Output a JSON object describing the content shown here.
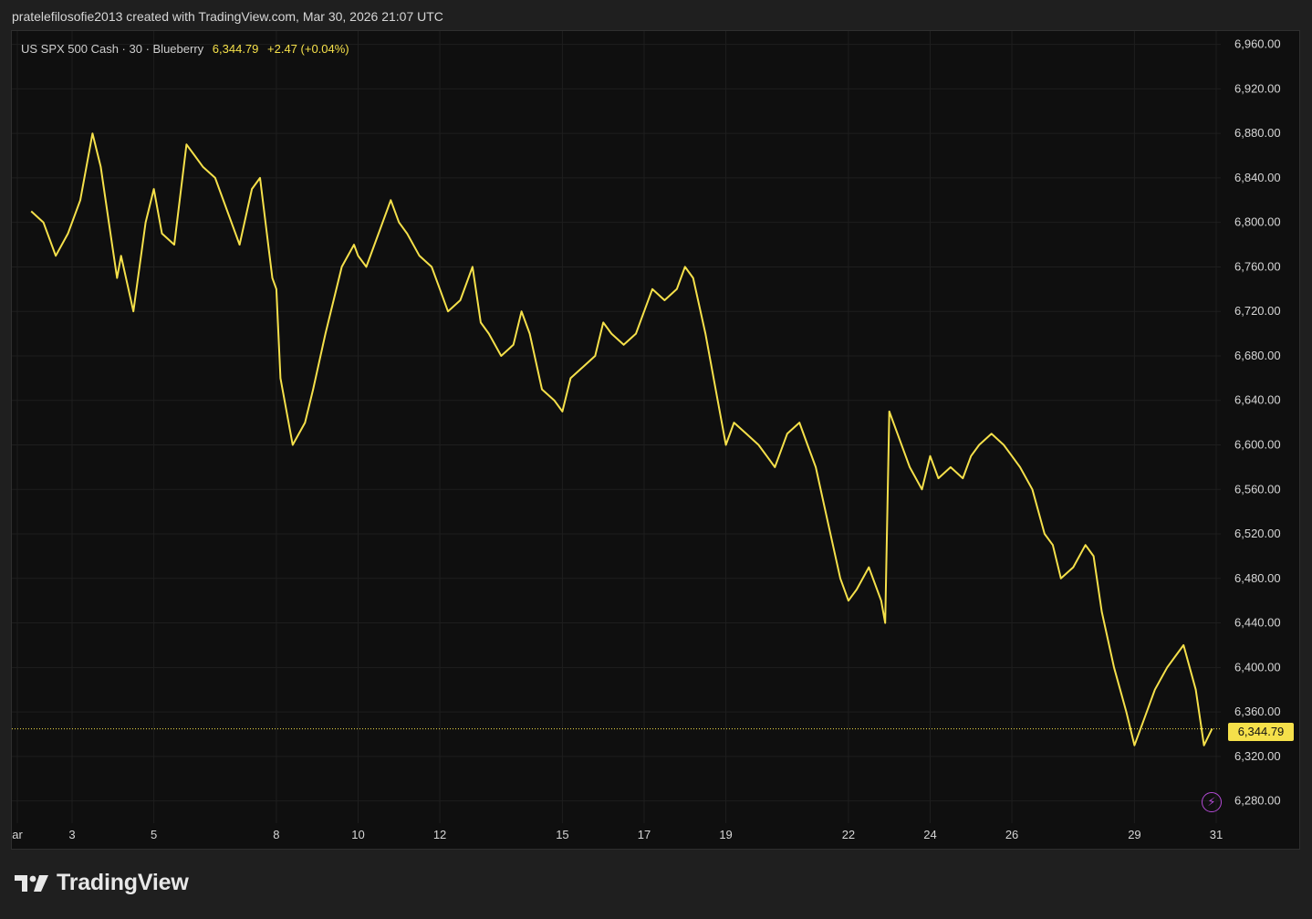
{
  "header": {
    "caption": "pratelefilosofie2013 created with TradingView.com, Mar 30, 2026 21:07 UTC"
  },
  "legend": {
    "symbol": "US SPX 500 Cash · 30 · Blueberry",
    "last": "6,344.79",
    "change": "+2.47 (+0.04%)"
  },
  "price_tag": "6,344.79",
  "branding": {
    "name": "TradingView",
    "icon": "tradingview-logo-icon"
  },
  "icons": {
    "alert": "lightning-bolt-icon"
  },
  "colors": {
    "line": "#f5e04a",
    "background": "#0f0f0f",
    "grid": "#1e1e1e",
    "axis_text": "#d6d6d6",
    "accent_purple": "#b44ad6"
  },
  "chart_data": {
    "type": "line",
    "title": "",
    "xlabel": "",
    "ylabel": "",
    "ylim": [
      6260,
      6972
    ],
    "y_ticks": [
      "6,960.00",
      "6,920.00",
      "6,880.00",
      "6,840.00",
      "6,800.00",
      "6,760.00",
      "6,720.00",
      "6,680.00",
      "6,640.00",
      "6,600.00",
      "6,560.00",
      "6,520.00",
      "6,480.00",
      "6,440.00",
      "6,400.00",
      "6,360.00",
      "6,320.00",
      "6,280.00"
    ],
    "y_tick_values": [
      6960,
      6920,
      6880,
      6840,
      6800,
      6760,
      6720,
      6680,
      6640,
      6600,
      6560,
      6520,
      6480,
      6440,
      6400,
      6360,
      6320,
      6280
    ],
    "x_ticks": [
      {
        "label": "ar",
        "day": 2
      },
      {
        "label": "3",
        "day": 3
      },
      {
        "label": "5",
        "day": 5
      },
      {
        "label": "8",
        "day": 8
      },
      {
        "label": "10",
        "day": 10
      },
      {
        "label": "12",
        "day": 12
      },
      {
        "label": "15",
        "day": 15
      },
      {
        "label": "17",
        "day": 17
      },
      {
        "label": "19",
        "day": 19
      },
      {
        "label": "22",
        "day": 22
      },
      {
        "label": "24",
        "day": 24
      },
      {
        "label": "26",
        "day": 26
      },
      {
        "label": "29",
        "day": 29
      },
      {
        "label": "31",
        "day": 31
      }
    ],
    "last_price": 6344.79,
    "grid": true,
    "series": [
      {
        "day": [
          2.0,
          2.3,
          2.6,
          2.9,
          3.2,
          3.5,
          3.7,
          3.9,
          4.1,
          4.2,
          4.5,
          4.8,
          5.0,
          5.2,
          5.5,
          5.8,
          6.0,
          6.2,
          6.5,
          6.8,
          7.1,
          7.4,
          7.6,
          7.8,
          7.9,
          8.0,
          8.1,
          8.4,
          8.7,
          8.9,
          9.2,
          9.6,
          9.9,
          10.0,
          10.2,
          10.5,
          10.8,
          11.0,
          11.2,
          11.5,
          11.8,
          12.0,
          12.2,
          12.5,
          12.8,
          13.0,
          13.2,
          13.5,
          13.8,
          14.0,
          14.2,
          14.5,
          14.8,
          15.0,
          15.2,
          15.5,
          15.8,
          16.0,
          16.2,
          16.5,
          16.8,
          17.0,
          17.2,
          17.5,
          17.8,
          18.0,
          18.2,
          18.5,
          18.8,
          19.0,
          19.2,
          19.5,
          19.8,
          20.0,
          20.2,
          20.5,
          20.8,
          21.0,
          21.2,
          21.5,
          21.8,
          22.0,
          22.2,
          22.5,
          22.8,
          22.9,
          23.0,
          23.2,
          23.5,
          23.8,
          24.0,
          24.2,
          24.5,
          24.8,
          25.0,
          25.2,
          25.5,
          25.8,
          26.0,
          26.2,
          26.5,
          26.8,
          27.0,
          27.2,
          27.5,
          27.8,
          28.0,
          28.2,
          28.5,
          28.8,
          29.0,
          29.2,
          29.5,
          29.8,
          30.0,
          30.2,
          30.5,
          30.7,
          30.9
        ],
        "values": [
          6810,
          6800,
          6770,
          6790,
          6820,
          6880,
          6850,
          6800,
          6750,
          6770,
          6720,
          6800,
          6830,
          6790,
          6780,
          6870,
          6860,
          6850,
          6840,
          6810,
          6780,
          6830,
          6840,
          6780,
          6750,
          6740,
          6660,
          6600,
          6620,
          6650,
          6700,
          6760,
          6780,
          6770,
          6760,
          6790,
          6820,
          6800,
          6790,
          6770,
          6760,
          6740,
          6720,
          6730,
          6760,
          6710,
          6700,
          6680,
          6690,
          6720,
          6700,
          6650,
          6640,
          6630,
          6660,
          6670,
          6680,
          6710,
          6700,
          6690,
          6700,
          6720,
          6740,
          6730,
          6740,
          6760,
          6750,
          6700,
          6640,
          6600,
          6620,
          6610,
          6600,
          6590,
          6580,
          6610,
          6620,
          6600,
          6580,
          6530,
          6480,
          6460,
          6470,
          6490,
          6460,
          6440,
          6630,
          6610,
          6580,
          6560,
          6590,
          6570,
          6580,
          6570,
          6590,
          6600,
          6610,
          6600,
          6590,
          6580,
          6560,
          6520,
          6510,
          6480,
          6490,
          6510,
          6500,
          6450,
          6400,
          6360,
          6330,
          6350,
          6380,
          6400,
          6410,
          6420,
          6380,
          6330,
          6345
        ]
      }
    ]
  }
}
